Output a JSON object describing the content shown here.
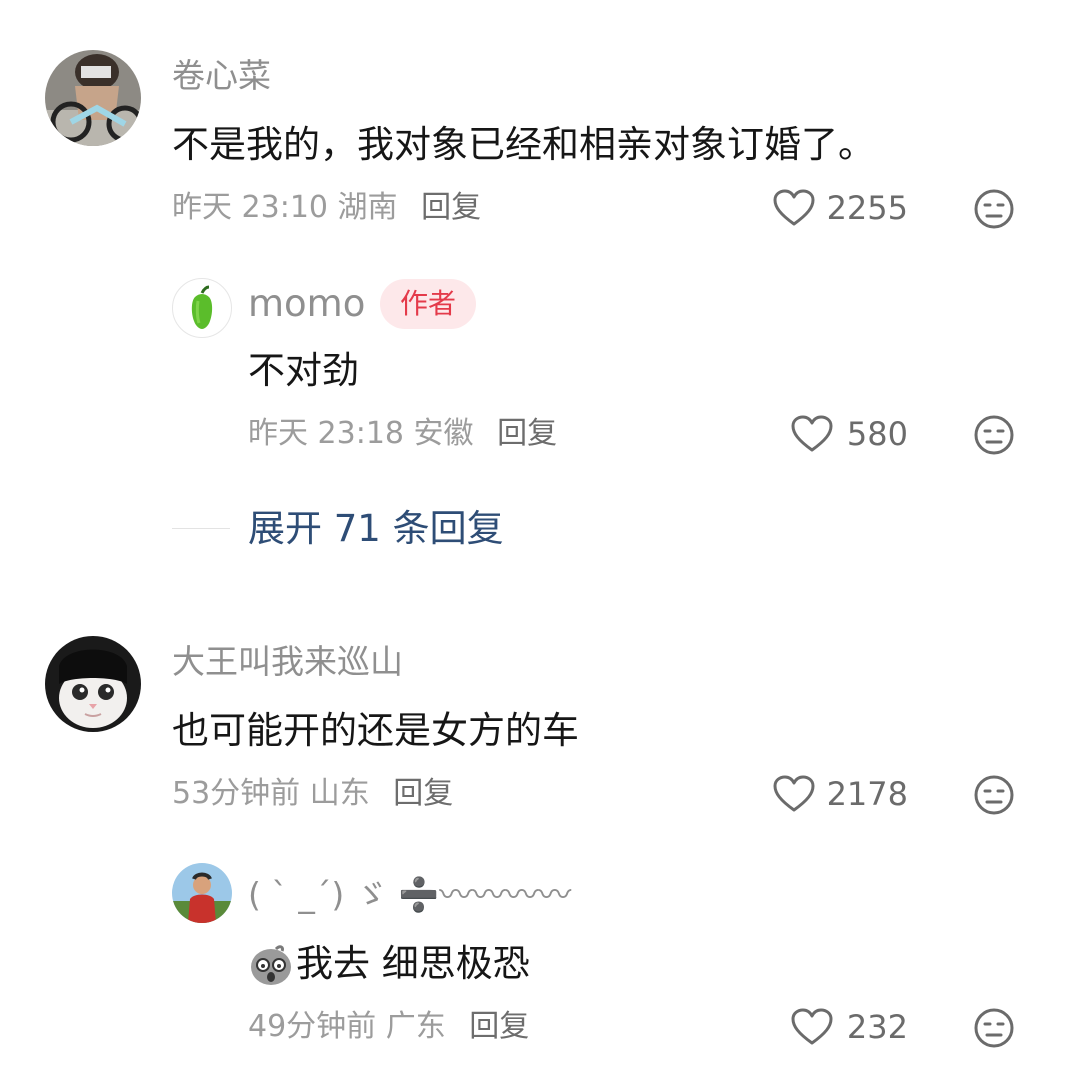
{
  "comments": [
    {
      "username": "卷心菜",
      "text": "不是我的，我对象已经和相亲对象订婚了。",
      "time": "昨天 23:10",
      "location": "湖南",
      "reply_label": "回复",
      "likes": "2255",
      "replies": [
        {
          "username": "momo",
          "author_tag": "作者",
          "text": "不对劲",
          "time": "昨天 23:18",
          "location": "安徽",
          "reply_label": "回复",
          "likes": "580"
        }
      ],
      "expand_label": "展开 71 条回复"
    },
    {
      "username": "大王叫我来巡山",
      "text": "也可能开的还是女方的车",
      "time": "53分钟前",
      "location": "山东",
      "reply_label": "回复",
      "likes": "2178",
      "replies": [
        {
          "username": "( ˋ _ˊ) ゞ ➗〰〰〰〰",
          "text": "我去 细思极恐",
          "time": "49分钟前",
          "location": "广东",
          "reply_label": "回复",
          "likes": "232"
        }
      ]
    }
  ],
  "icons": {
    "like": "heart-outline-icon",
    "dislike": "meh-face-icon",
    "pepper_avatar": "green-pepper-icon",
    "sticker": "shocked-bird-sticker-icon"
  },
  "colors": {
    "author_tag_bg": "#fde8ea",
    "author_tag_text": "#e43a4a",
    "expand_link": "#2e4d76",
    "meta_text": "#9c9c9c"
  }
}
